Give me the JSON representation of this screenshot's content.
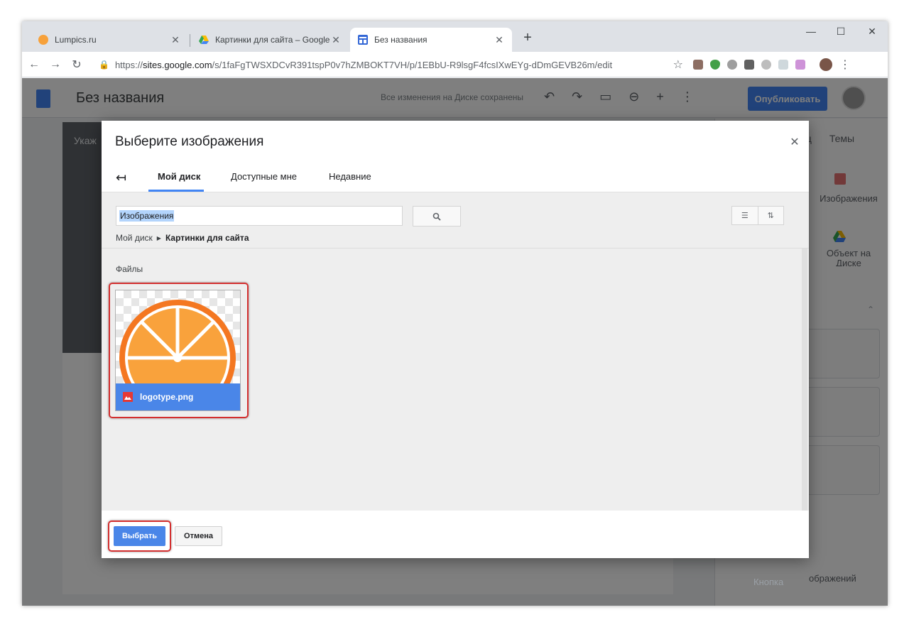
{
  "browser": {
    "tabs": [
      {
        "title": "Lumpics.ru"
      },
      {
        "title": "Картинки для сайта – Google Д"
      },
      {
        "title": "Без названия"
      }
    ],
    "url_secure": "https://",
    "url_domain": "sites.google.com",
    "url_path": "/s/1faFgTWSXDCvR391tspP0v7hZMBOKT7VH/p/1EBbU-R9lsgF4fcsIXwEYg-dDmGEVB26m/edit"
  },
  "app": {
    "site_title": "Без названия",
    "saved_status": "Все изменения на Диске сохранены",
    "publish_label": "Опубликовать",
    "banner_text": "Укаж"
  },
  "right_panel": {
    "tabs": [
      "иц",
      "Темы"
    ],
    "images_label": "Изображения",
    "drive_label_1": "Объект на",
    "drive_label_2": "Диске",
    "carousel_label": "ображений",
    "button_label": "Кнопка"
  },
  "dialog": {
    "title": "Выберите изображения",
    "tabs": [
      {
        "label": "Мой диск"
      },
      {
        "label": "Доступные мне"
      },
      {
        "label": "Недавние"
      }
    ],
    "search_value": "Изображения",
    "breadcrumb": {
      "root": "Мой диск",
      "current": "Картинки для сайта"
    },
    "section_label": "Файлы",
    "files": [
      {
        "name": "logotype.png"
      }
    ],
    "select_label": "Выбрать",
    "cancel_label": "Отмена"
  },
  "colors": {
    "accent": "#4a86e8",
    "highlight": "#d32f2f",
    "orange": "#f7a13a"
  }
}
